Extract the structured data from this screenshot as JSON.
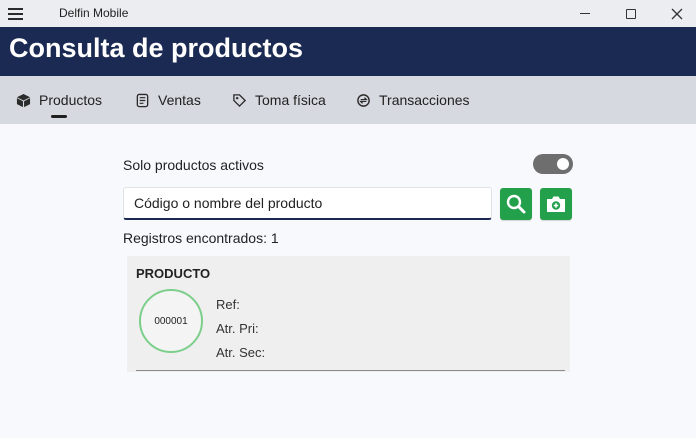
{
  "window": {
    "title": "Delfin Mobile"
  },
  "header": {
    "title": "Consulta de productos"
  },
  "tabs": [
    {
      "label": "Productos",
      "icon": "cube-icon",
      "selected": true
    },
    {
      "label": "Ventas",
      "icon": "receipt-icon",
      "selected": false
    },
    {
      "label": "Toma física",
      "icon": "tag-icon",
      "selected": false
    },
    {
      "label": "Transacciones",
      "icon": "exchange-icon",
      "selected": false
    }
  ],
  "filters": {
    "active_only_label": "Solo productos activos",
    "active_only": true
  },
  "search": {
    "placeholder": "Código o nombre del producto",
    "value": ""
  },
  "results": {
    "count_label": "Registros encontrados: 1",
    "items": [
      {
        "title": "PRODUCTO",
        "code": "000001",
        "ref_label": "Ref:",
        "atr_pri_label": "Atr. Pri:",
        "atr_sec_label": "Atr. Sec:"
      }
    ]
  },
  "colors": {
    "header_bg": "#1b2a52",
    "tabs_bg": "#d7d9e0",
    "accent_green": "#22a04b",
    "avatar_border": "#7ccf8a"
  }
}
